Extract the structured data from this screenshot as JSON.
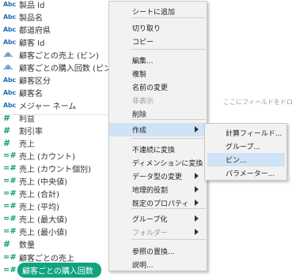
{
  "data_pane": {
    "fields": [
      {
        "icon": "Abc",
        "label": "製品 Id",
        "kind": "dimension"
      },
      {
        "icon": "Abc",
        "label": "製品名",
        "kind": "dimension"
      },
      {
        "icon": "Abc",
        "label": "都道府県",
        "kind": "dimension"
      },
      {
        "icon": "Abc",
        "label": "顧客 Id",
        "kind": "dimension"
      },
      {
        "icon": ".ılı.",
        "label": "顧客ごとの売上 (ビン)",
        "kind": "bin"
      },
      {
        "icon": ".ılı.",
        "label": "顧客ごとの購入回数 (ビン)",
        "kind": "bin"
      },
      {
        "icon": "Abc",
        "label": "顧客区分",
        "kind": "dimension"
      },
      {
        "icon": "Abc",
        "label": "顧客名",
        "kind": "dimension"
      },
      {
        "icon": "Abc",
        "label": "メジャー ネーム",
        "kind": "dimension"
      },
      {
        "icon": "#",
        "label": "利益",
        "kind": "measure"
      },
      {
        "icon": "#",
        "label": "割引率",
        "kind": "measure"
      },
      {
        "icon": "#",
        "label": "売上",
        "kind": "measure"
      },
      {
        "icon": "=#",
        "label": "売上 (カウント)",
        "kind": "calc"
      },
      {
        "icon": "=#",
        "label": "売上 (カウント個別)",
        "kind": "calc"
      },
      {
        "icon": "=#",
        "label": "売上 (中央値)",
        "kind": "calc"
      },
      {
        "icon": "=#",
        "label": "売上 (合計)",
        "kind": "calc"
      },
      {
        "icon": "=#",
        "label": "売上 (平均)",
        "kind": "calc"
      },
      {
        "icon": "=#",
        "label": "売上 (最大値)",
        "kind": "calc"
      },
      {
        "icon": "=#",
        "label": "売上 (最小値)",
        "kind": "calc"
      },
      {
        "icon": "#",
        "label": "数量",
        "kind": "measure"
      },
      {
        "icon": "=#",
        "label": "顧客ごとの売上",
        "kind": "calc"
      },
      {
        "icon": "=#",
        "label": "顧客ごとの購入回数",
        "kind": "calc",
        "selected": true
      }
    ]
  },
  "drop_hint": "ここにフィールドをドロップ",
  "context_menu": {
    "items": [
      {
        "label": "シートに追加"
      },
      {
        "label": "切り取り"
      },
      {
        "label": "コピー"
      },
      {
        "label": "編集..."
      },
      {
        "label": "複製"
      },
      {
        "label": "名前の変更"
      },
      {
        "label": "非表示",
        "disabled": true
      },
      {
        "label": "削除"
      },
      {
        "label": "作成",
        "submenu": true,
        "highlighted": true
      },
      {
        "label": "不連続に変換"
      },
      {
        "label": "ディメンションに変換"
      },
      {
        "label": "データ型の変更",
        "submenu": true
      },
      {
        "label": "地理的役割",
        "submenu": true
      },
      {
        "label": "既定のプロパティ",
        "submenu": true
      },
      {
        "label": "グループ化",
        "submenu": true
      },
      {
        "label": "フォルダー",
        "submenu": true,
        "disabled": true
      },
      {
        "label": "参照の置換..."
      },
      {
        "label": "説明..."
      }
    ]
  },
  "submenu": {
    "items": [
      {
        "label": "計算フィールド..."
      },
      {
        "label": "グループ..."
      },
      {
        "label": "ビン...",
        "highlighted": true
      },
      {
        "label": "パラメーター..."
      }
    ]
  },
  "colors": {
    "dimension_icon": "#1f6fb5",
    "measure_icon": "#0e9f6e",
    "selected_pill": "#0fa37f",
    "menu_highlight": "#cfe3f6",
    "menu_bg": "#f2f2f2"
  }
}
